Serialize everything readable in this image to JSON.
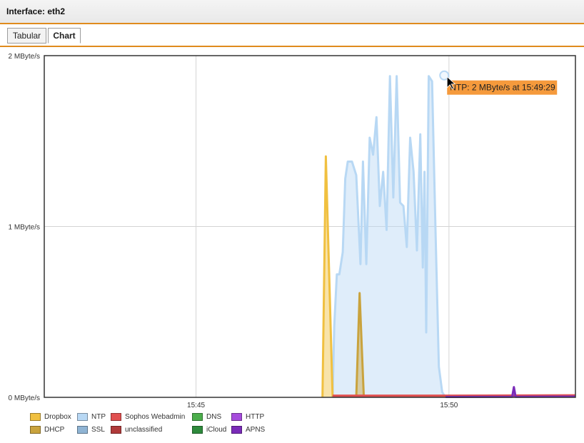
{
  "header": {
    "title": "Interface: eth2"
  },
  "tabs": [
    {
      "label": "Tabular",
      "active": false
    },
    {
      "label": "Chart",
      "active": true
    }
  ],
  "chart_data": {
    "type": "area",
    "y_ticks": [
      "0 MByte/s",
      "1 MByte/s",
      "2 MByte/s"
    ],
    "ylim": [
      0,
      2
    ],
    "x_ticks": [
      "15:45",
      "15:50"
    ],
    "xlim": [
      "15:42:00",
      "15:52:30"
    ],
    "grid": true,
    "legend_position": "bottom-left",
    "tooltip": {
      "text": "NTP: 2 MByte/s at 15:49:29",
      "series": "NTP",
      "x": "15:49:29",
      "y": 1.88
    },
    "series": [
      {
        "name": "Dropbox",
        "color": "#f0c040",
        "points": [
          [
            "15:47:30",
            0
          ],
          [
            "15:47:34",
            1.41
          ],
          [
            "15:47:42",
            0
          ]
        ]
      },
      {
        "name": "DHCP",
        "color": "#c9a33d",
        "points": [
          [
            "15:48:10",
            0
          ],
          [
            "15:48:14",
            0.61
          ],
          [
            "15:48:19",
            0
          ]
        ]
      },
      {
        "name": "NTP",
        "color": "#b8d8f4",
        "points": [
          [
            "15:47:42",
            0
          ],
          [
            "15:47:44",
            0.42
          ],
          [
            "15:47:47",
            0.72
          ],
          [
            "15:47:50",
            0.72
          ],
          [
            "15:47:54",
            0.85
          ],
          [
            "15:47:57",
            1.28
          ],
          [
            "15:48:00",
            1.38
          ],
          [
            "15:48:05",
            1.38
          ],
          [
            "15:48:10",
            1.3
          ],
          [
            "15:48:15",
            0.78
          ],
          [
            "15:48:18",
            1.38
          ],
          [
            "15:48:22",
            0.78
          ],
          [
            "15:48:26",
            1.52
          ],
          [
            "15:48:30",
            1.42
          ],
          [
            "15:48:34",
            1.64
          ],
          [
            "15:48:38",
            1.12
          ],
          [
            "15:48:42",
            1.32
          ],
          [
            "15:48:46",
            0.98
          ],
          [
            "15:48:50",
            1.88
          ],
          [
            "15:48:54",
            1.17
          ],
          [
            "15:48:58",
            1.88
          ],
          [
            "15:49:02",
            1.14
          ],
          [
            "15:49:06",
            1.12
          ],
          [
            "15:49:10",
            0.88
          ],
          [
            "15:49:14",
            1.52
          ],
          [
            "15:49:18",
            1.32
          ],
          [
            "15:49:22",
            0.86
          ],
          [
            "15:49:26",
            1.54
          ],
          [
            "15:49:29",
            0.76
          ],
          [
            "15:49:31",
            1.32
          ],
          [
            "15:49:33",
            0.38
          ],
          [
            "15:49:36",
            1.88
          ],
          [
            "15:49:40",
            1.85
          ],
          [
            "15:49:44",
            0.98
          ],
          [
            "15:49:48",
            0.18
          ],
          [
            "15:49:52",
            0.03
          ],
          [
            "15:49:56",
            0
          ]
        ]
      },
      {
        "name": "SSL",
        "color": "#8fb4d4",
        "points": []
      },
      {
        "name": "Sophos Webadmin",
        "color": "#e05050",
        "points": [
          [
            "15:47:42",
            0.01
          ],
          [
            "15:50:00",
            0.01
          ],
          [
            "15:52:30",
            0.012
          ]
        ]
      },
      {
        "name": "unclassified",
        "color": "#b03a3a",
        "points": [
          [
            "15:47:42",
            0.008
          ],
          [
            "15:52:30",
            0.01
          ]
        ]
      },
      {
        "name": "DNS",
        "color": "#4cae4c",
        "points": [
          [
            "15:47:42",
            0.004
          ],
          [
            "15:49:56",
            0.004
          ]
        ]
      },
      {
        "name": "iCloud",
        "color": "#2e8a3c",
        "points": []
      },
      {
        "name": "HTTP",
        "color": "#a64cdc",
        "points": []
      },
      {
        "name": "APNS",
        "color": "#7a2bb8",
        "points": [
          [
            "15:49:56",
            0.002
          ],
          [
            "15:51:15",
            0.003
          ],
          [
            "15:51:17",
            0.06
          ],
          [
            "15:51:19",
            0.003
          ],
          [
            "15:52:30",
            0.004
          ]
        ]
      }
    ]
  }
}
